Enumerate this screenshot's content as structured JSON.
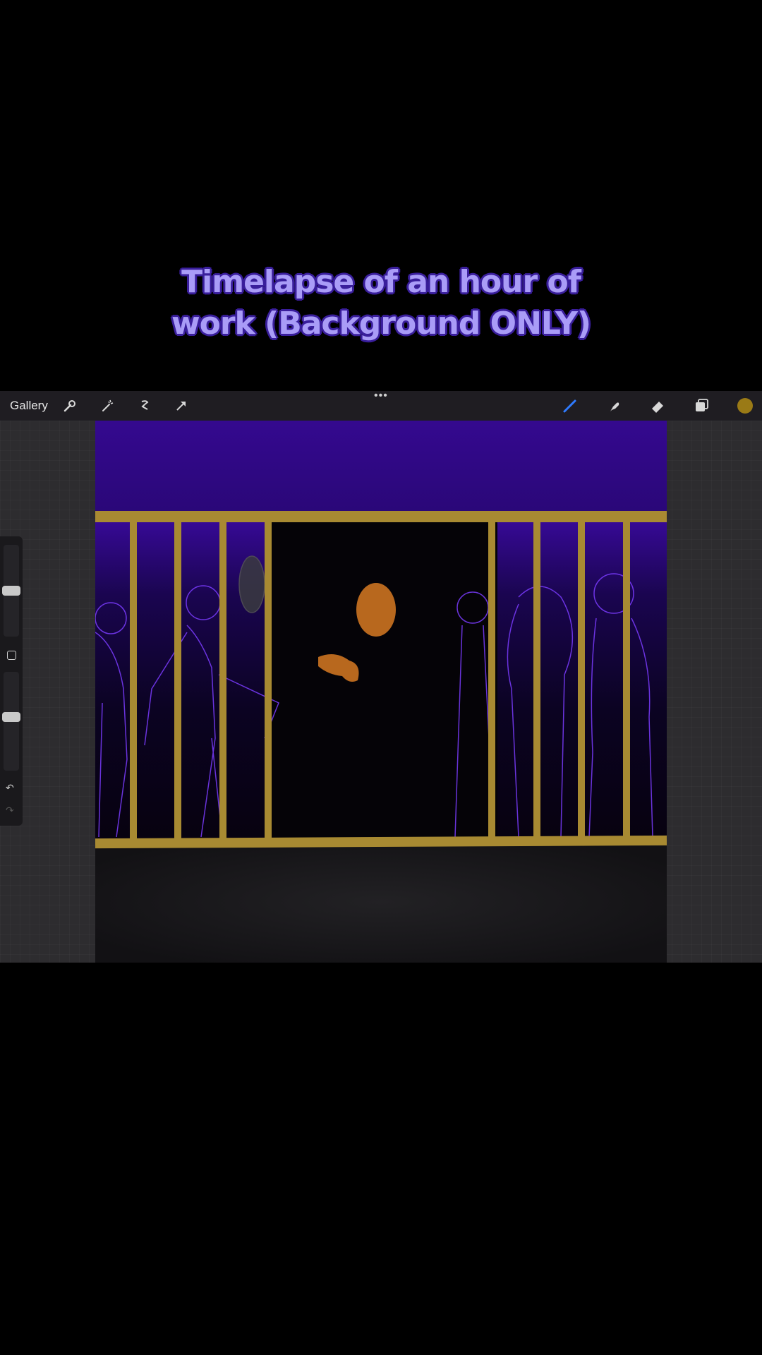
{
  "caption": {
    "line1": "Timelapse of an hour of",
    "line2": "work (Background ONLY)"
  },
  "toolbar": {
    "gallery_label": "Gallery",
    "more_label": "•••",
    "left_icons": [
      "wrench-icon",
      "magic-wand-icon",
      "selection-icon",
      "transform-arrow-icon"
    ],
    "right_icons": [
      "brush-icon",
      "smudge-icon",
      "eraser-icon",
      "layers-icon",
      "color-swatch-icon"
    ],
    "current_color": "#9a7a16"
  },
  "sidebar": {
    "brush_size": 0.5,
    "opacity": 0.55,
    "undo_glyph": "↶",
    "redo_glyph": "↷"
  },
  "colors": {
    "sky_purple": "#3a0a9e",
    "railing_gold": "#a88a32",
    "figure_outline": "#7b3cff",
    "skin_orange": "#b8681e"
  }
}
